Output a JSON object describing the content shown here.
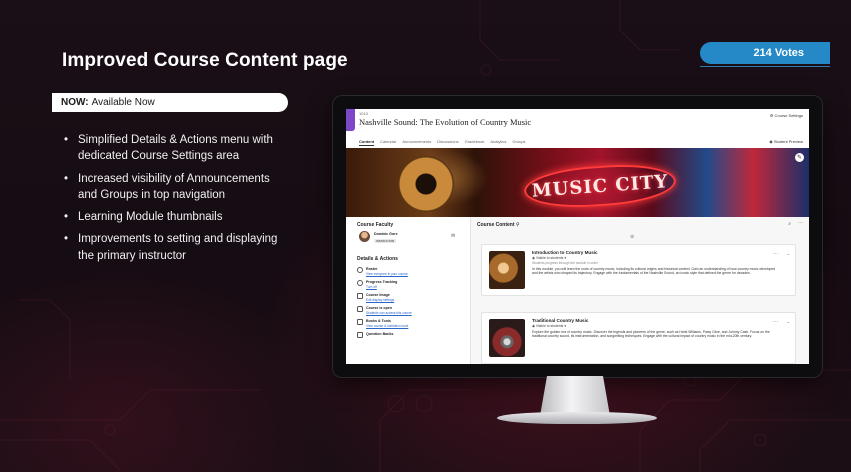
{
  "slide": {
    "title": "Improved Course Content page",
    "votes": "214 Votes",
    "status_label": "NOW:",
    "status_value": "Available Now",
    "bullets": [
      "Simplified Details & Actions menu with dedicated Course Settings area",
      "Increased visibility of Announcements and Groups in top navigation",
      "Learning Module thumbnails",
      "Improvements to setting and displaying the primary instructor"
    ],
    "colors": {
      "accent": "#2589c7",
      "background": "#160c13"
    }
  },
  "screen": {
    "course_code": "1013",
    "course_title": "Nashville Sound: The Evolution of Country Music",
    "course_settings": "Course Settings",
    "student_preview": "Student Preview",
    "tabs": [
      "Content",
      "Calendar",
      "Announcements",
      "Discussions",
      "Gradebook",
      "Analytics",
      "Groups"
    ],
    "active_tab": "Content",
    "hero_text": "MUSIC CITY",
    "faculty": {
      "heading": "Course Faculty",
      "name": "Dominic Gore",
      "role": "INSTRUCTOR"
    },
    "details_actions": {
      "heading": "Details & Actions",
      "items": [
        {
          "title": "Roster",
          "link": "View everyone in your course",
          "icon": "people-icon"
        },
        {
          "title": "Progress Tracking",
          "link": "Turn off",
          "icon": "progress-icon"
        },
        {
          "title": "Course Image",
          "link": "Edit display settings",
          "icon": "image-icon"
        },
        {
          "title": "Course is open",
          "link": "Students can access this course",
          "icon": "lock-icon"
        },
        {
          "title": "Books & Tools",
          "link": "View course & institution tools",
          "icon": "tools-icon"
        },
        {
          "title": "Question Banks",
          "link": "",
          "icon": "bank-icon"
        }
      ]
    },
    "content": {
      "heading": "Course Content",
      "modules": [
        {
          "title": "Introduction to Country Music",
          "visibility": "Visible to students",
          "subtitle": "Students progress through the module in order",
          "description": "In this module, you will learn the roots of country music, including its cultural origins and historical context. Gain an understanding of how country music developed and the artists who shaped its trajectory. Engage with the fundamentals of the Nashville Sound, an iconic style that defined the genre for decades."
        },
        {
          "title": "Traditional Country Music",
          "visibility": "Visible to students",
          "subtitle": "",
          "description": "Explore the golden era of country music. Discover the legends and pioneers of the genre, such as Hank Williams, Patsy Cline, and Johnny Cash. Focus on the traditional country sound, its instrumentation, and songwriting techniques. Engage with the cultural impact of country music in the mid-20th century."
        }
      ]
    }
  }
}
